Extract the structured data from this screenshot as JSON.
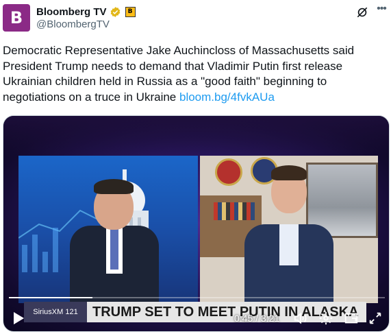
{
  "author": {
    "display_name": "Bloomberg TV",
    "handle": "@BloombergTV",
    "avatar_letter": "B",
    "avatar_color": "#8b2a86",
    "verified_badge": "gold-verified-icon",
    "affiliate_badge_letter": "B"
  },
  "tweet": {
    "text": "Democratic Representative Jake Auchincloss of Massachusetts said President Trump needs to demand that Vladimir Putin first release Ukrainian children held in Russia as a \"good faith\" beginning to negotiations on a truce in Ukraine ",
    "link_text": "bloom.bg/4fvkAUa",
    "link_color": "#1d9bf0"
  },
  "video": {
    "chyron_logo": "SiriusXM 121",
    "chyron_text": "TRUMP SET TO MEET PUTIN IN ALASKA",
    "time_display": "0:45 / 3:21",
    "progress_fraction": 0.223
  },
  "icons": {
    "grok": "grok-icon",
    "more": "more-icon",
    "play": "play-icon",
    "volume": "volume-icon",
    "settings": "settings-icon",
    "pip": "picture-in-picture-icon",
    "fullscreen": "fullscreen-icon"
  }
}
